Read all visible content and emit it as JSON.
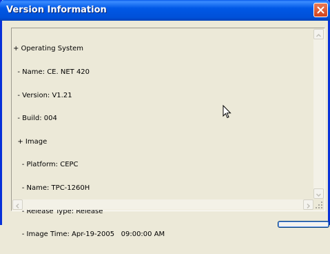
{
  "window": {
    "title": "Version Information"
  },
  "tree": {
    "lines": [
      "+ Operating System",
      "  - Name: CE. NET 420",
      "  - Version: V1.21",
      "  - Build: 004",
      "  + Image",
      "    - Platform: CEPC",
      "    - Name: TPC-1260H",
      "    - Release Type: Release",
      "    - Image Time: Apr-19-2005   09:00:00 AM"
    ]
  },
  "colors": {
    "titlebar": "#0058E6",
    "window_bg": "#ECE9D8",
    "close_button": "#D4431C"
  },
  "icons": {
    "close": "close-icon",
    "scroll_up": "arrow-up-icon",
    "scroll_down": "arrow-down-icon",
    "scroll_left": "arrow-left-icon",
    "scroll_right": "arrow-right-icon",
    "cursor": "mouse-cursor-icon"
  }
}
